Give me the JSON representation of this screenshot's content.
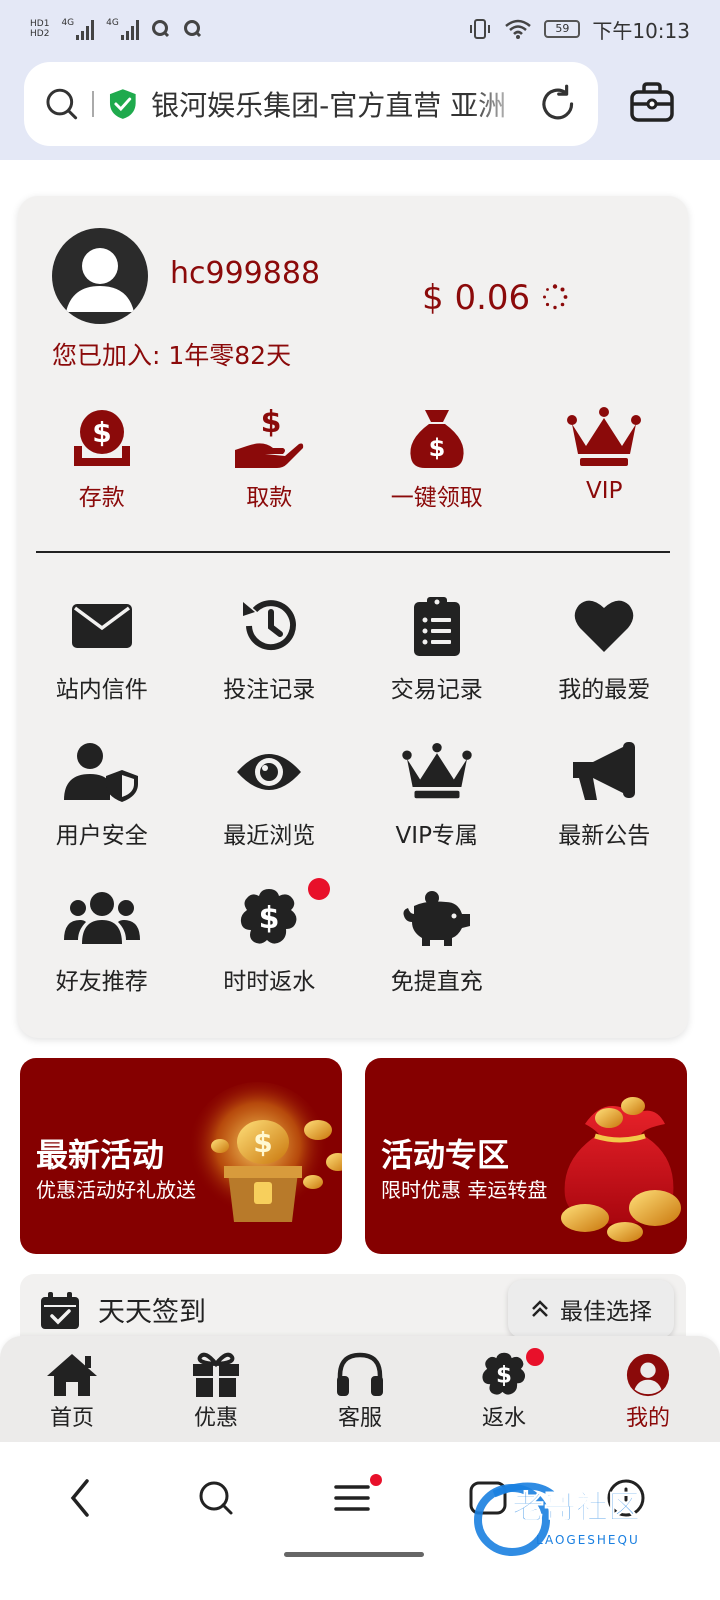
{
  "status_bar": {
    "hd1": "HD1",
    "hd2": "HD2",
    "net1": "4G",
    "net2": "4G",
    "battery": "59",
    "time": "下午10:13"
  },
  "browser": {
    "url_text": "银河娱乐集团-官方直营 亚洲"
  },
  "profile": {
    "username": "hc999888",
    "balance": "$ 0.06",
    "joined": "您已加入: 1年零82天"
  },
  "quick_actions": [
    {
      "label": "存款",
      "icon": "deposit-icon"
    },
    {
      "label": "取款",
      "icon": "withdraw-icon"
    },
    {
      "label": "一键领取",
      "icon": "money-bag-icon"
    },
    {
      "label": "VIP",
      "icon": "crown-icon"
    }
  ],
  "menu": [
    {
      "label": "站内信件",
      "icon": "mail-icon"
    },
    {
      "label": "投注记录",
      "icon": "history-icon"
    },
    {
      "label": "交易记录",
      "icon": "clipboard-list-icon"
    },
    {
      "label": "我的最爱",
      "icon": "heart-icon"
    },
    {
      "label": "用户安全",
      "icon": "user-shield-icon"
    },
    {
      "label": "最近浏览",
      "icon": "eye-icon"
    },
    {
      "label": "VIP专属",
      "icon": "crown-icon"
    },
    {
      "label": "最新公告",
      "icon": "megaphone-icon"
    },
    {
      "label": "好友推荐",
      "icon": "users-icon"
    },
    {
      "label": "时时返水",
      "icon": "dollar-badge-icon"
    },
    {
      "label": "免提直充",
      "icon": "piggy-bank-icon"
    }
  ],
  "banners": [
    {
      "title": "最新活动",
      "subtitle": "优惠活动好礼放送"
    },
    {
      "title": "活动专区",
      "subtitle": "限时优惠 幸运转盘"
    }
  ],
  "signin": {
    "label": "天天签到"
  },
  "best_choice": {
    "label": "最佳选择"
  },
  "bottom_nav": [
    {
      "label": "首页",
      "icon": "home-icon"
    },
    {
      "label": "优惠",
      "icon": "gift-icon"
    },
    {
      "label": "客服",
      "icon": "headset-icon"
    },
    {
      "label": "返水",
      "icon": "dollar-badge-icon"
    },
    {
      "label": "我的",
      "icon": "user-circle-icon",
      "active": true
    }
  ],
  "watermark": {
    "text": "老哥社区",
    "sub": "LAOGESHEQU"
  },
  "colors": {
    "accent": "#8b0a0a",
    "banner": "#850000",
    "dot": "#e8102a"
  }
}
